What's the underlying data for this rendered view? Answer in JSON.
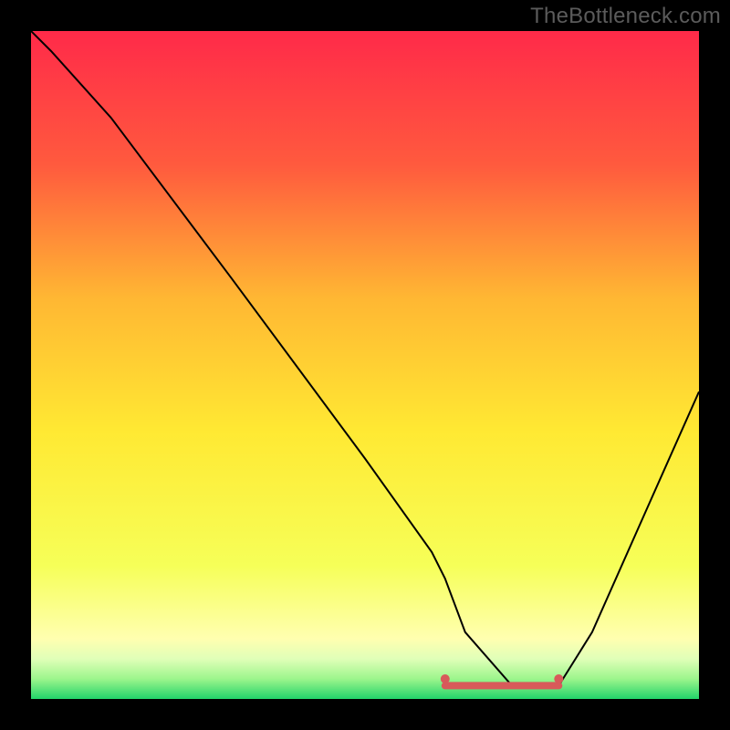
{
  "watermark": "TheBottleneck.com",
  "chart_data": {
    "type": "line",
    "title": "",
    "xlabel": "",
    "ylabel": "",
    "xlim": [
      0,
      100
    ],
    "ylim": [
      0,
      100
    ],
    "grid": false,
    "legend": false,
    "annotations": [],
    "background": {
      "type": "vertical-gradient",
      "stops": [
        {
          "pct": 0,
          "color": "#ff2a49"
        },
        {
          "pct": 20,
          "color": "#ff5a3e"
        },
        {
          "pct": 40,
          "color": "#ffb733"
        },
        {
          "pct": 60,
          "color": "#ffe933"
        },
        {
          "pct": 80,
          "color": "#f6ff58"
        },
        {
          "pct": 91,
          "color": "#ffffb0"
        },
        {
          "pct": 94,
          "color": "#e0ffb8"
        },
        {
          "pct": 97,
          "color": "#9cf58c"
        },
        {
          "pct": 100,
          "color": "#22d36a"
        }
      ]
    },
    "series": [
      {
        "name": "bottleneck-curve",
        "color": "#000000",
        "stroke_width": 2,
        "x": [
          0,
          3,
          12,
          30,
          50,
          60,
          62,
          65,
          72,
          77,
          79,
          84,
          92,
          100
        ],
        "values": [
          100,
          97,
          87,
          63,
          36,
          22,
          18,
          10,
          2,
          2,
          2,
          10,
          28,
          46
        ]
      }
    ],
    "flat_segment": {
      "color": "#d85a5a",
      "stroke_width": 8,
      "x_start": 62,
      "x_end": 79,
      "y": 2,
      "dots": [
        {
          "x": 62,
          "y": 3
        },
        {
          "x": 79,
          "y": 3
        }
      ]
    }
  }
}
